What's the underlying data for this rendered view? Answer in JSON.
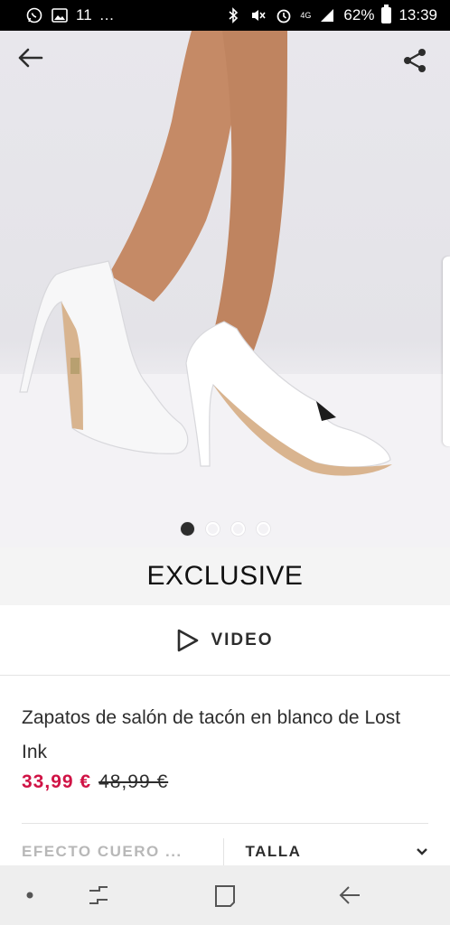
{
  "status_bar": {
    "notification_count": "11",
    "ellipsis": "…",
    "network": "4G",
    "battery": "62%",
    "time": "13:39"
  },
  "gallery": {
    "image_count": 4,
    "active_index": 0
  },
  "badge": "EXCLUSIVE",
  "video": {
    "label": "VIDEO"
  },
  "product": {
    "title": "Zapatos de salón de tacón en blanco de Lost Ink",
    "price_current": "33,99 €",
    "price_original": "48,99 €"
  },
  "options": {
    "colour_label": "EFECTO CUERO ...",
    "size_label": "TALLA"
  },
  "colors": {
    "sale": "#d01345",
    "text": "#2d2d2d"
  }
}
